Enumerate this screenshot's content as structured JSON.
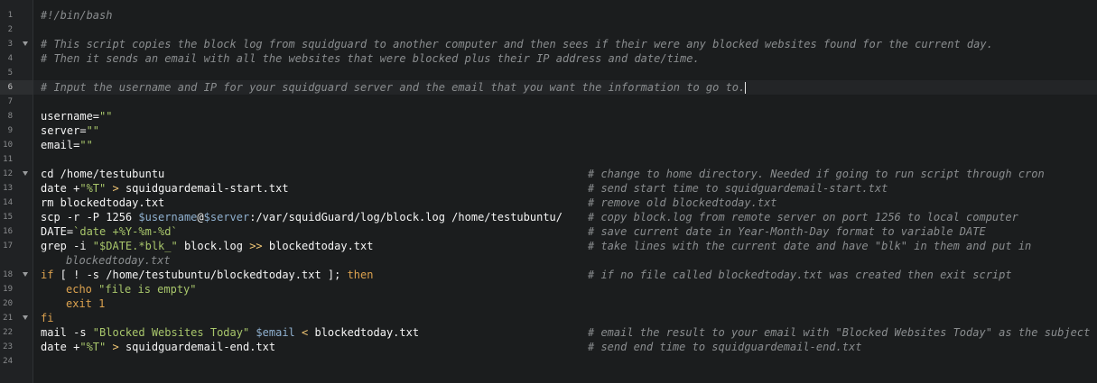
{
  "gutter": {
    "line_numbers": [
      "1",
      "2",
      "3",
      "4",
      "5",
      "6",
      "7",
      "8",
      "9",
      "10",
      "11",
      "12",
      "13",
      "14",
      "15",
      "16",
      "17",
      "",
      "18",
      "19",
      "20",
      "21",
      "22",
      "23",
      "24"
    ]
  },
  "code": {
    "l1": "#!/bin/bash",
    "l3": "# This script copies the block log from squidguard to another computer and then sees if their were any blocked websites found for the current day.",
    "l4": "# Then it sends an email with all the websites that were blocked plus their IP address and date/time.",
    "l6": "# Input the username and IP for your squidguard server and the email that you want the information to go to.",
    "l8_a": "username=",
    "l8_b": "\"\"",
    "l9_a": "server=",
    "l9_b": "\"\"",
    "l10_a": "email=",
    "l10_b": "\"\"",
    "l12": "cd /home/testubuntu",
    "l12_c": "# change to home directory. Needed if going to run script through cron",
    "l13_a": "date +",
    "l13_b": "\"%T\"",
    "l13_c": " > ",
    "l13_d": "squidguardemail-start.txt",
    "l13_e": "# send start time to squidguardemail-start.txt",
    "l14": "rm blockedtoday.txt",
    "l14_c": "# remove old blockedtoday.txt",
    "l15_a": "scp -r -P 1256 ",
    "l15_b": "$username",
    "l15_c": "@",
    "l15_d": "$server",
    "l15_e": ":/var/squidGuard/log/block.log /home/testubuntu/",
    "l15_f": "# copy block.log from remote server on port 1256 to local computer",
    "l16_a": "DATE=",
    "l16_b": "`date +%Y-%m-%d`",
    "l16_c": "# save current date in Year-Month-Day format to variable DATE",
    "l17_a": "grep -i ",
    "l17_b": "\"$DATE.*blk_\"",
    "l17_c": " block.log ",
    "l17_d": ">>",
    "l17_e": " blockedtoday.txt",
    "l17_f": "# take lines with the current date and have \"blk\" in them and put in",
    "l17_wrap": "blockedtoday.txt",
    "l18_a": "if",
    "l18_b": " [ ! -s /home/testubuntu/blockedtoday.txt ]; ",
    "l18_c": "then",
    "l18_d": "# if no file called blockedtoday.txt was created then exit script",
    "l19_a": "echo ",
    "l19_b": "\"file is empty\"",
    "l20": "exit 1",
    "l21": "fi",
    "l22_a": "mail -s ",
    "l22_b": "\"Blocked Websites Today\"",
    "l22_c": " ",
    "l22_d": "$email",
    "l22_e": " < ",
    "l22_f": "blockedtoday.txt",
    "l22_g": "# email the result to your email with \"Blocked Websites Today\" as the subject",
    "l23_a": "date +",
    "l23_b": "\"%T\"",
    "l23_c": " > ",
    "l23_d": "squidguardemail-end.txt",
    "l23_e": "# send end time to squidguardemail-end.txt"
  }
}
